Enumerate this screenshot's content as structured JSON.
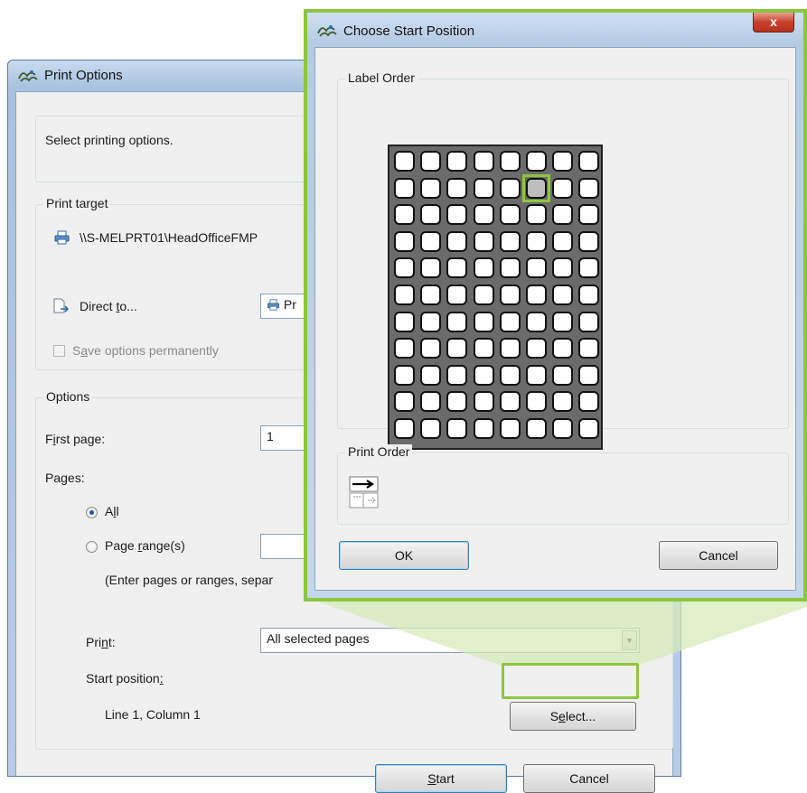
{
  "print_options": {
    "title": "Print Options",
    "description": "Select printing options.",
    "print_target": {
      "label": "Print target",
      "printer": "\\\\S-MELPRT01\\HeadOfficeFMP",
      "direct_to_pre": "Direct ",
      "direct_to_u": "t",
      "direct_to_post": "o...",
      "direct_to_value": "Pr",
      "save_pre": "S",
      "save_u": "a",
      "save_post": "ve options permanently",
      "save_checked": false
    },
    "options": {
      "label": "Options",
      "first_page_pre": "F",
      "first_page_u": "i",
      "first_page_post": "rst page:",
      "first_page_value": "1",
      "pages_label": "Pages:",
      "all_pre": "A",
      "all_u": "l",
      "all_post": "l",
      "range_pre": "Page ",
      "range_u": "r",
      "range_post": "ange(s)",
      "range_value": "",
      "range_hint": "(Enter pages or ranges, separ",
      "selected_radio": "all",
      "print_pre": "Pri",
      "print_u": "n",
      "print_post": "t:",
      "print_value": "All selected pages",
      "start_pre": "Start position",
      "start_u": ":",
      "start_value": "Line 1, Column 1",
      "select_pre": "S",
      "select_u": "e",
      "select_post": "lect..."
    },
    "start_button_u": "S",
    "start_button_post": "tart",
    "cancel_button": "Cancel"
  },
  "choose_start": {
    "title": "Choose Start Position",
    "close_glyph": "x",
    "label_order_label": "Label Order",
    "grid": {
      "columns": 8,
      "rows": 11,
      "selected_row": 2,
      "selected_column": 6
    },
    "print_order_label": "Print Order",
    "print_order_icon": "print-order-row-arrows-icon",
    "ok_button": "OK",
    "cancel_button": "Cancel"
  },
  "colors": {
    "highlight": "#8cc63f",
    "title_bar": "#b4cbe5",
    "dialog_bg": "#f0f0f0",
    "close_red": "#c7412c"
  }
}
